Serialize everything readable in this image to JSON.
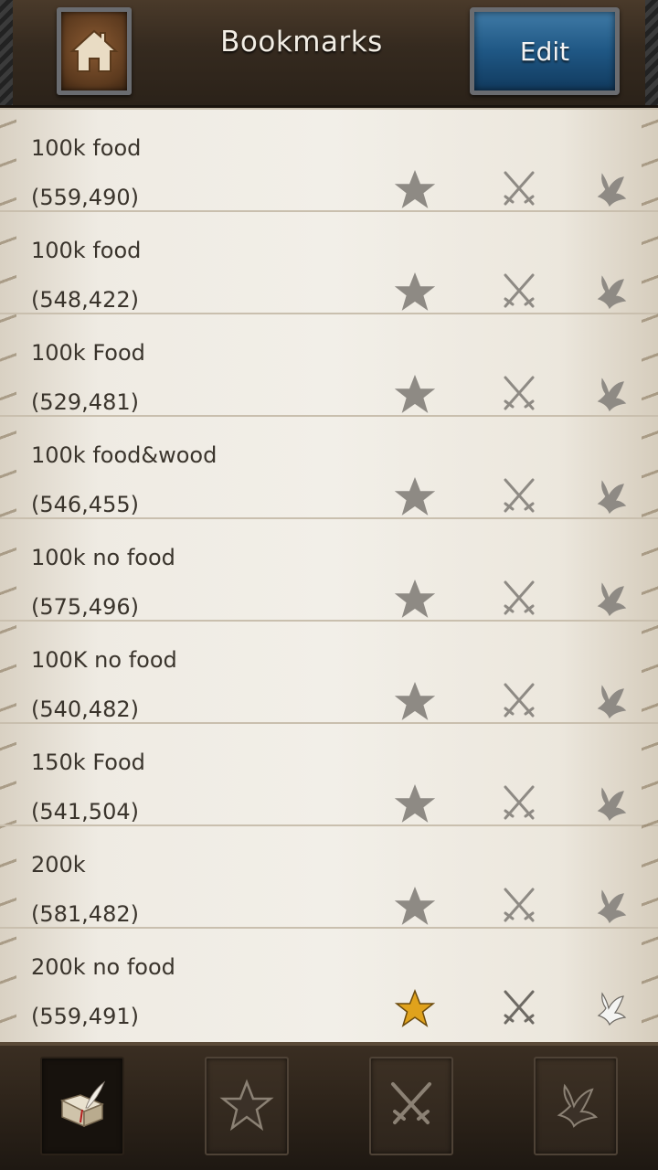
{
  "header": {
    "title": "Bookmarks",
    "edit_label": "Edit",
    "home_icon": "house-icon"
  },
  "bookmarks": [
    {
      "name": "100k food",
      "coords": "(559,490)",
      "favorite": false
    },
    {
      "name": "100k food",
      "coords": "(548,422)",
      "favorite": false
    },
    {
      "name": "100k Food",
      "coords": "(529,481)",
      "favorite": false
    },
    {
      "name": "100k food&wood",
      "coords": "(546,455)",
      "favorite": false
    },
    {
      "name": "100k no food",
      "coords": "(575,496)",
      "favorite": false
    },
    {
      "name": "100K no food",
      "coords": "(540,482)",
      "favorite": false
    },
    {
      "name": "150k Food",
      "coords": "(541,504)",
      "favorite": false
    },
    {
      "name": "200k",
      "coords": "(581,482)",
      "favorite": false
    },
    {
      "name": "200k no food",
      "coords": "(559,491)",
      "favorite": true
    }
  ],
  "row_icons": [
    "star-icon",
    "crossed-swords-icon",
    "dove-icon"
  ],
  "tabs": [
    {
      "icon": "book-quill-icon",
      "active": true
    },
    {
      "icon": "star-icon",
      "active": false
    },
    {
      "icon": "crossed-swords-icon",
      "active": false
    },
    {
      "icon": "dove-icon",
      "active": false
    }
  ],
  "colors": {
    "edit_button": "#1f5784",
    "favorite_star": "#e0a21c",
    "inactive_icon": "#8e8a84",
    "text": "#3a342c"
  }
}
